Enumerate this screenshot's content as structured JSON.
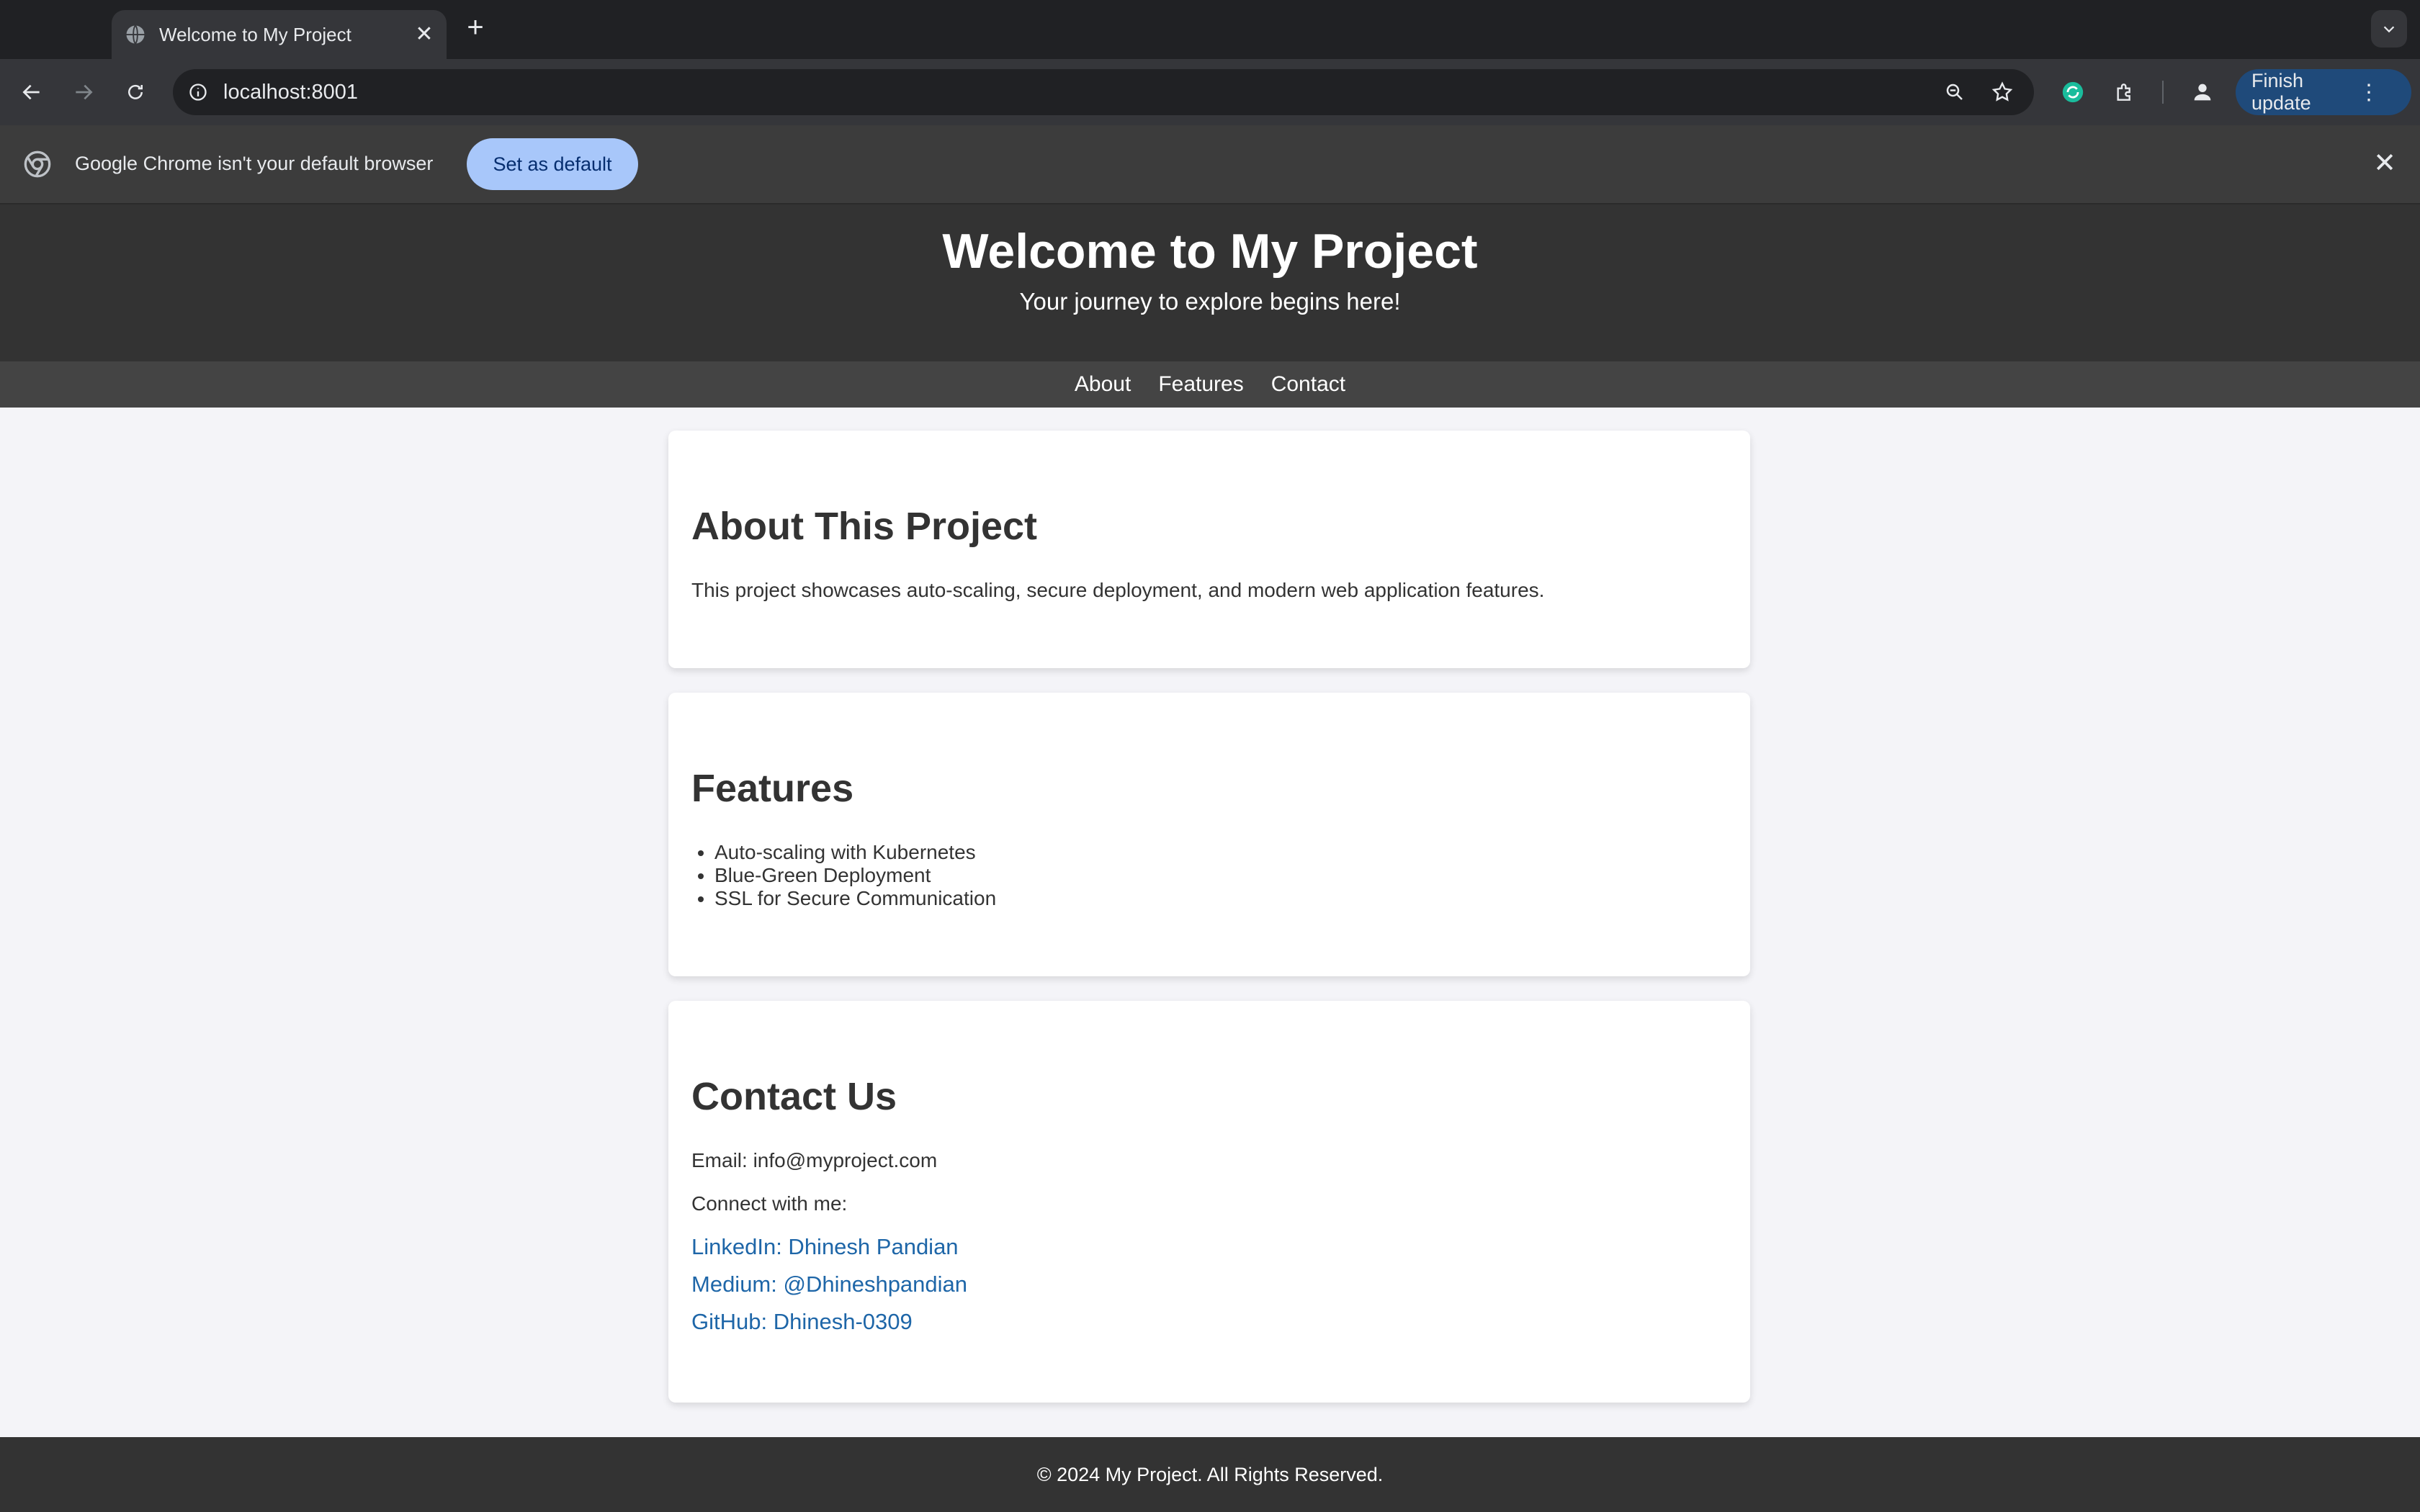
{
  "browser": {
    "tab_title": "Welcome to My Project",
    "url": "localhost:8001",
    "finish_update_label": "Finish update",
    "infobar_text": "Google Chrome isn't your default browser",
    "set_default_label": "Set as default",
    "icons": [
      "globe-icon",
      "close-icon",
      "plus-icon",
      "back-icon",
      "forward-icon",
      "reload-icon",
      "info-icon",
      "zoom-icon",
      "star-icon",
      "extension-icon",
      "puzzle-icon",
      "profile-icon",
      "more-icon",
      "chrome-icon"
    ]
  },
  "page": {
    "header": {
      "title": "Welcome to My Project",
      "subtitle": "Your journey to explore begins here!"
    },
    "nav": [
      "About",
      "Features",
      "Contact"
    ],
    "about": {
      "heading": "About This Project",
      "text": "This project showcases auto-scaling, secure deployment, and modern web application features."
    },
    "features": {
      "heading": "Features",
      "items": [
        "Auto-scaling with Kubernetes",
        "Blue-Green Deployment",
        "SSL for Secure Communication"
      ]
    },
    "contact": {
      "heading": "Contact Us",
      "email": "Email: info@myproject.com",
      "connect": "Connect with me:",
      "links": [
        "LinkedIn: Dhinesh Pandian",
        "Medium: @Dhineshpandian",
        "GitHub: Dhinesh-0309"
      ]
    },
    "footer": "© 2024 My Project. All Rights Reserved."
  }
}
